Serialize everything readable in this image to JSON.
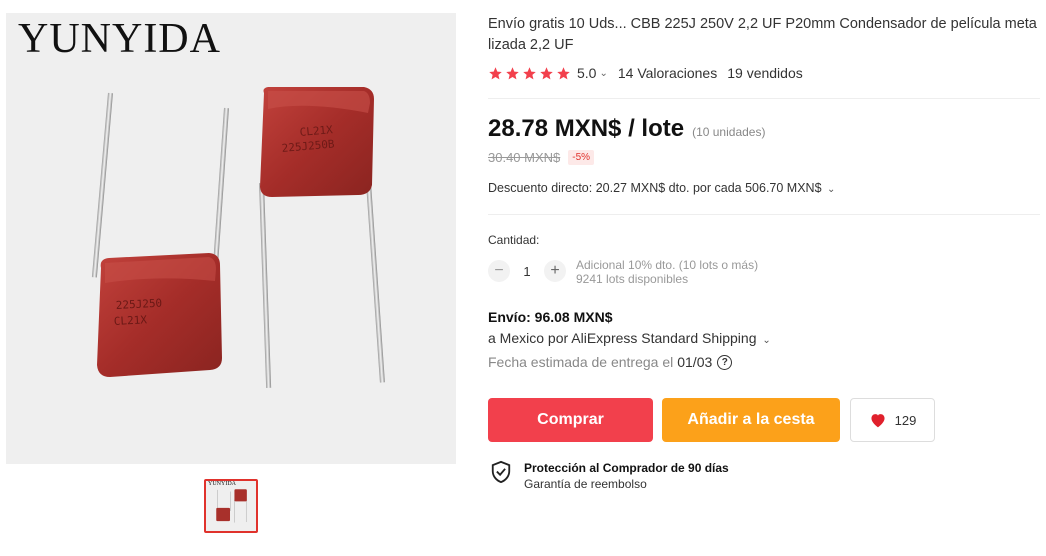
{
  "gallery": {
    "brand": "YUNYIDA",
    "cap1_marking_line1": "CL21X",
    "cap1_marking_line2": "225J250B",
    "cap2_marking_line1": "225J250",
    "cap2_marking_line2": "CL21X",
    "thumb_brand": "YUNYIDA"
  },
  "product": {
    "title": "Envío gratis 10 Uds... CBB 225J 250V 2,2 UF P20mm Condensador de película metalizada 2,2 UF",
    "rating": "5.0",
    "reviews": "14 Valoraciones",
    "sold": "19 vendidos",
    "price": "28.78 MXN$ / lote",
    "units": "(10 unidades)",
    "old_price": "30.40 MXN$",
    "discount": "-5%",
    "coupon": "Descuento directo: 20.27 MXN$ dto. por cada 506.70 MXN$"
  },
  "quantity": {
    "label": "Cantidad:",
    "value": "1",
    "minus": "−",
    "plus": "+",
    "note_line1": "Adicional 10% dto. (10 lots o más)",
    "note_line2": "9241 lots disponibles"
  },
  "shipping": {
    "title": "Envío: 96.08 MXN$",
    "via": "a Mexico por AliExpress Standard Shipping",
    "date_prefix": "Fecha estimada de entrega el",
    "date": "01/03",
    "help": "?"
  },
  "actions": {
    "buy": "Comprar",
    "add_to_cart": "Añadir a la cesta",
    "wishlist_count": "129"
  },
  "protection": {
    "title": "Protección al Comprador de 90 días",
    "subtitle": "Garantía de reembolso"
  },
  "colors": {
    "star": "#f2404c",
    "buy": "#f2404c",
    "cart": "#fca11a",
    "heart": "#e0202c",
    "capacitor": "#a8302b"
  },
  "icons": [
    "star-icon",
    "chevron-down-icon",
    "question-icon",
    "heart-icon",
    "shield-check-icon"
  ]
}
